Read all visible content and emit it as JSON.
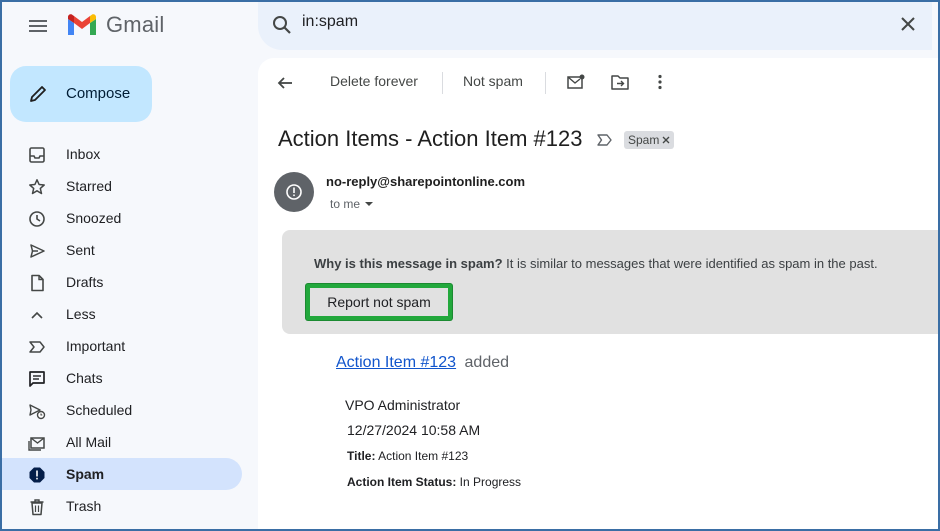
{
  "app": {
    "name": "Gmail"
  },
  "search": {
    "value": "in:spam"
  },
  "compose": {
    "label": "Compose"
  },
  "sidebar": {
    "items": [
      {
        "label": "Inbox",
        "icon": "inbox-icon"
      },
      {
        "label": "Starred",
        "icon": "star-icon"
      },
      {
        "label": "Snoozed",
        "icon": "clock-icon"
      },
      {
        "label": "Sent",
        "icon": "send-icon"
      },
      {
        "label": "Drafts",
        "icon": "draft-icon"
      },
      {
        "label": "Less",
        "icon": "chevron-up-icon"
      },
      {
        "label": "Important",
        "icon": "label-important-icon"
      },
      {
        "label": "Chats",
        "icon": "chat-icon"
      },
      {
        "label": "Scheduled",
        "icon": "scheduled-send-icon"
      },
      {
        "label": "All Mail",
        "icon": "all-mail-icon"
      },
      {
        "label": "Spam",
        "icon": "spam-icon",
        "active": true
      },
      {
        "label": "Trash",
        "icon": "trash-icon"
      }
    ]
  },
  "toolbar": {
    "delete_forever": "Delete forever",
    "not_spam": "Not spam"
  },
  "message": {
    "subject": "Action Items - Action Item #123",
    "label": "Spam",
    "sender": "no-reply@sharepointonline.com",
    "to": "to me",
    "spam_question": "Why is this message in spam?",
    "spam_reason": " It is similar to messages that were identified as spam in the past.",
    "report_not_spam": "Report not spam",
    "link_text": "Action Item #123",
    "link_suffix": "added",
    "author": "VPO Administrator",
    "datetime": "12/27/2024 10:58 AM",
    "title_label": "Title:",
    "title_value": " Action Item #123",
    "status_label": "Action Item Status:",
    "status_value": " In Progress"
  },
  "colors": {
    "accent": "#c2e7ff",
    "active_nav": "#d3e3fd",
    "highlight_border": "#22a83c",
    "link": "#1155cc"
  }
}
